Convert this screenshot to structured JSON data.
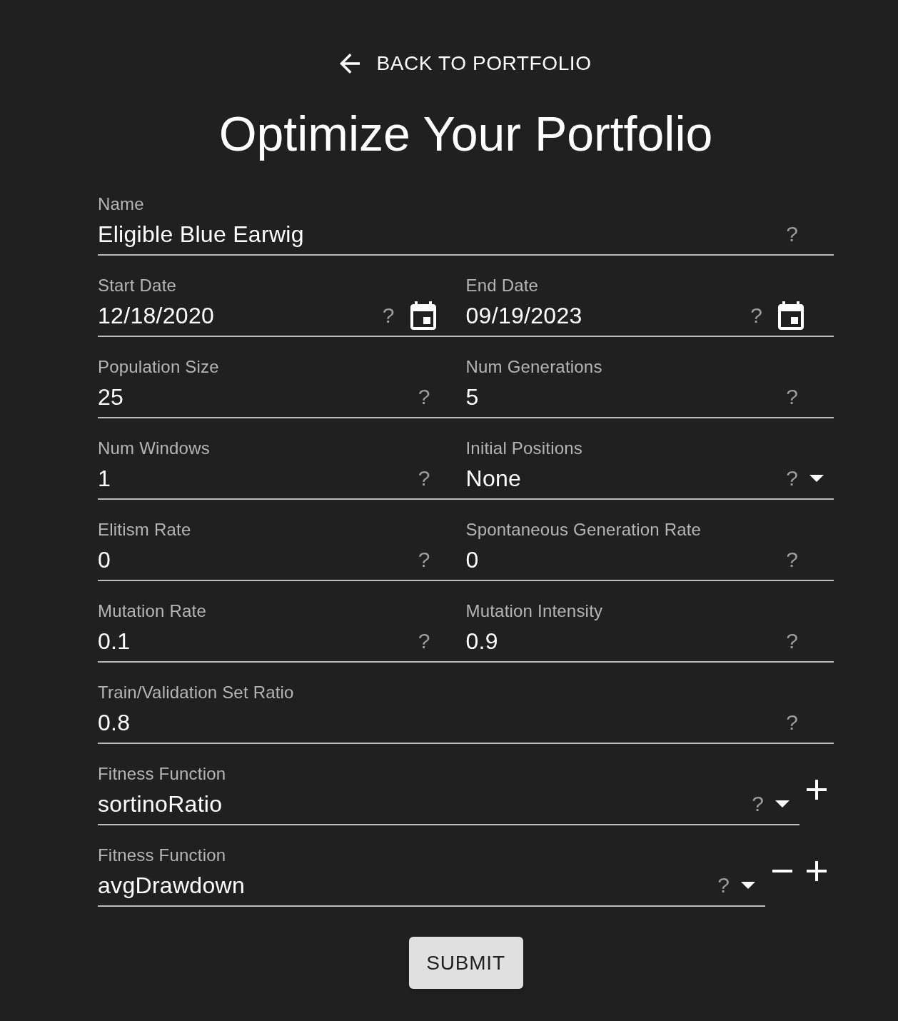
{
  "back_link": {
    "label": "BACK TO PORTFOLIO"
  },
  "title": "Optimize Your Portfolio",
  "rows": [
    {
      "fields": [
        {
          "kind": "text",
          "label": "Name",
          "value": "Eligible Blue Earwig",
          "help": "?"
        }
      ]
    },
    {
      "fields": [
        {
          "kind": "date",
          "label": "Start Date",
          "value": "12/18/2020",
          "help": "?"
        },
        {
          "kind": "date",
          "label": "End Date",
          "value": "09/19/2023",
          "help": "?"
        }
      ]
    },
    {
      "fields": [
        {
          "kind": "text",
          "label": "Population Size",
          "value": "25",
          "help": "?"
        },
        {
          "kind": "text",
          "label": "Num Generations",
          "value": "5",
          "help": "?"
        }
      ]
    },
    {
      "fields": [
        {
          "kind": "text",
          "label": "Num Windows",
          "value": "1",
          "help": "?"
        },
        {
          "kind": "select",
          "label": "Initial Positions",
          "value": "None",
          "help": "?"
        }
      ]
    },
    {
      "fields": [
        {
          "kind": "text",
          "label": "Elitism Rate",
          "value": "0",
          "help": "?"
        },
        {
          "kind": "text",
          "label": "Spontaneous Generation Rate",
          "value": "0",
          "help": "?"
        }
      ]
    },
    {
      "fields": [
        {
          "kind": "text",
          "label": "Mutation Rate",
          "value": "0.1",
          "help": "?"
        },
        {
          "kind": "text",
          "label": "Mutation Intensity",
          "value": "0.9",
          "help": "?"
        }
      ]
    },
    {
      "fields": [
        {
          "kind": "text",
          "label": "Train/Validation Set Ratio",
          "value": "0.8",
          "help": "?"
        }
      ]
    }
  ],
  "fitness_functions": [
    {
      "kind": "select",
      "label": "Fitness Function",
      "value": "sortinoRatio",
      "help": "?",
      "removable": false,
      "addable": true
    },
    {
      "kind": "select",
      "label": "Fitness Function",
      "value": "avgDrawdown",
      "help": "?",
      "removable": true,
      "addable": true
    }
  ],
  "submit": {
    "label": "SUBMIT"
  }
}
